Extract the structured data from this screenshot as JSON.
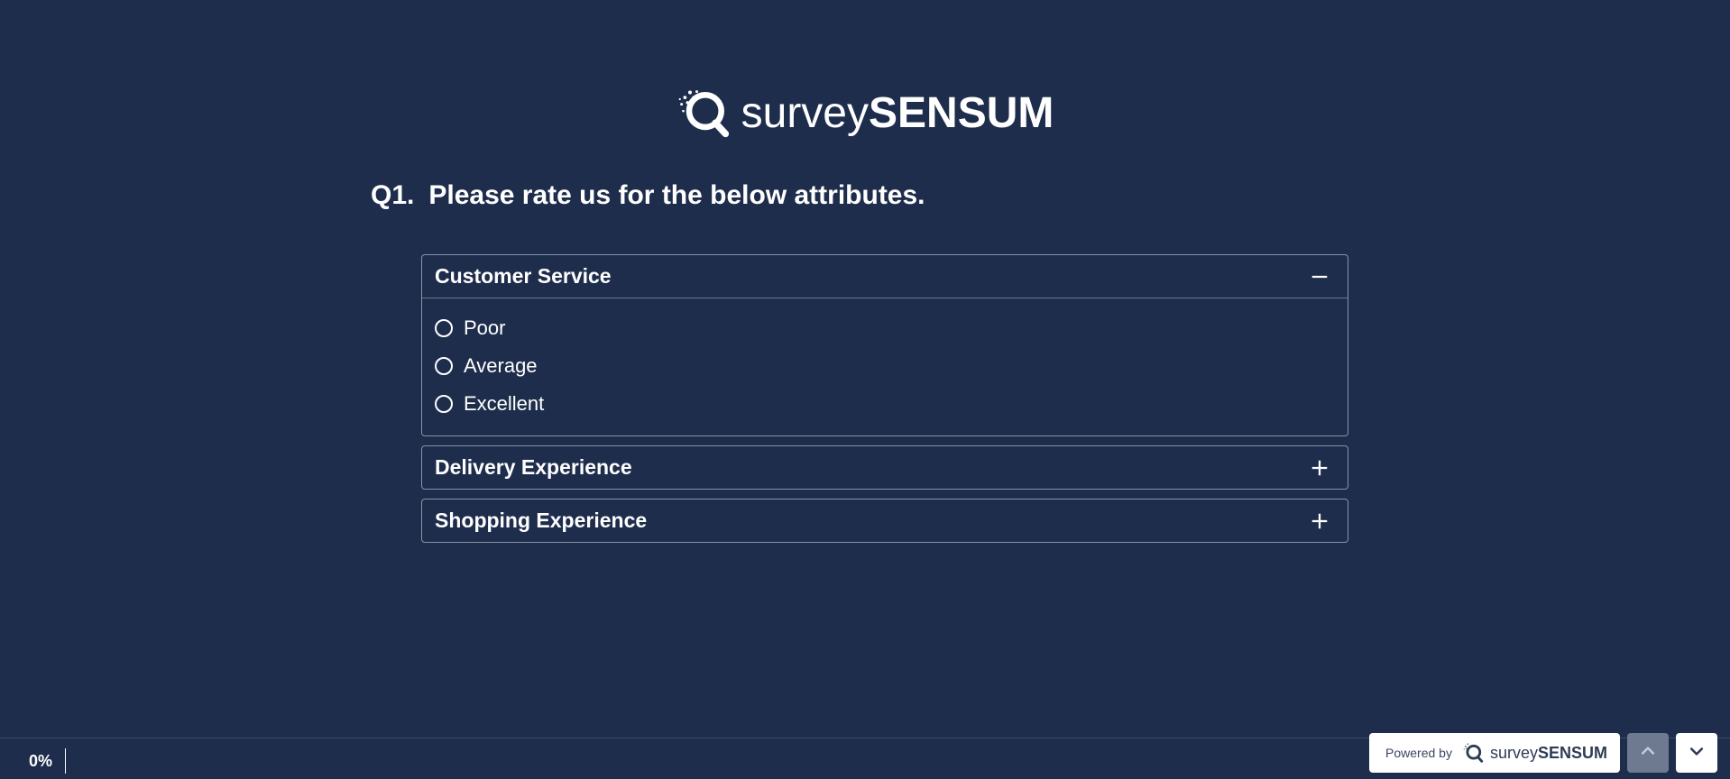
{
  "brand": {
    "name_light": "survey",
    "name_bold": "SENSUM"
  },
  "question": {
    "number": "Q1.",
    "text": "Please rate us for the below attributes."
  },
  "attributes": [
    {
      "title": "Customer Service",
      "expanded": true,
      "options": [
        "Poor",
        "Average",
        "Excellent"
      ]
    },
    {
      "title": "Delivery Experience",
      "expanded": false,
      "options": []
    },
    {
      "title": "Shopping Experience",
      "expanded": false,
      "options": []
    }
  ],
  "footer": {
    "progress": "0%",
    "powered_by_label": "Powered by",
    "powered_brand_light": "survey",
    "powered_brand_bold": "SENSUM"
  }
}
